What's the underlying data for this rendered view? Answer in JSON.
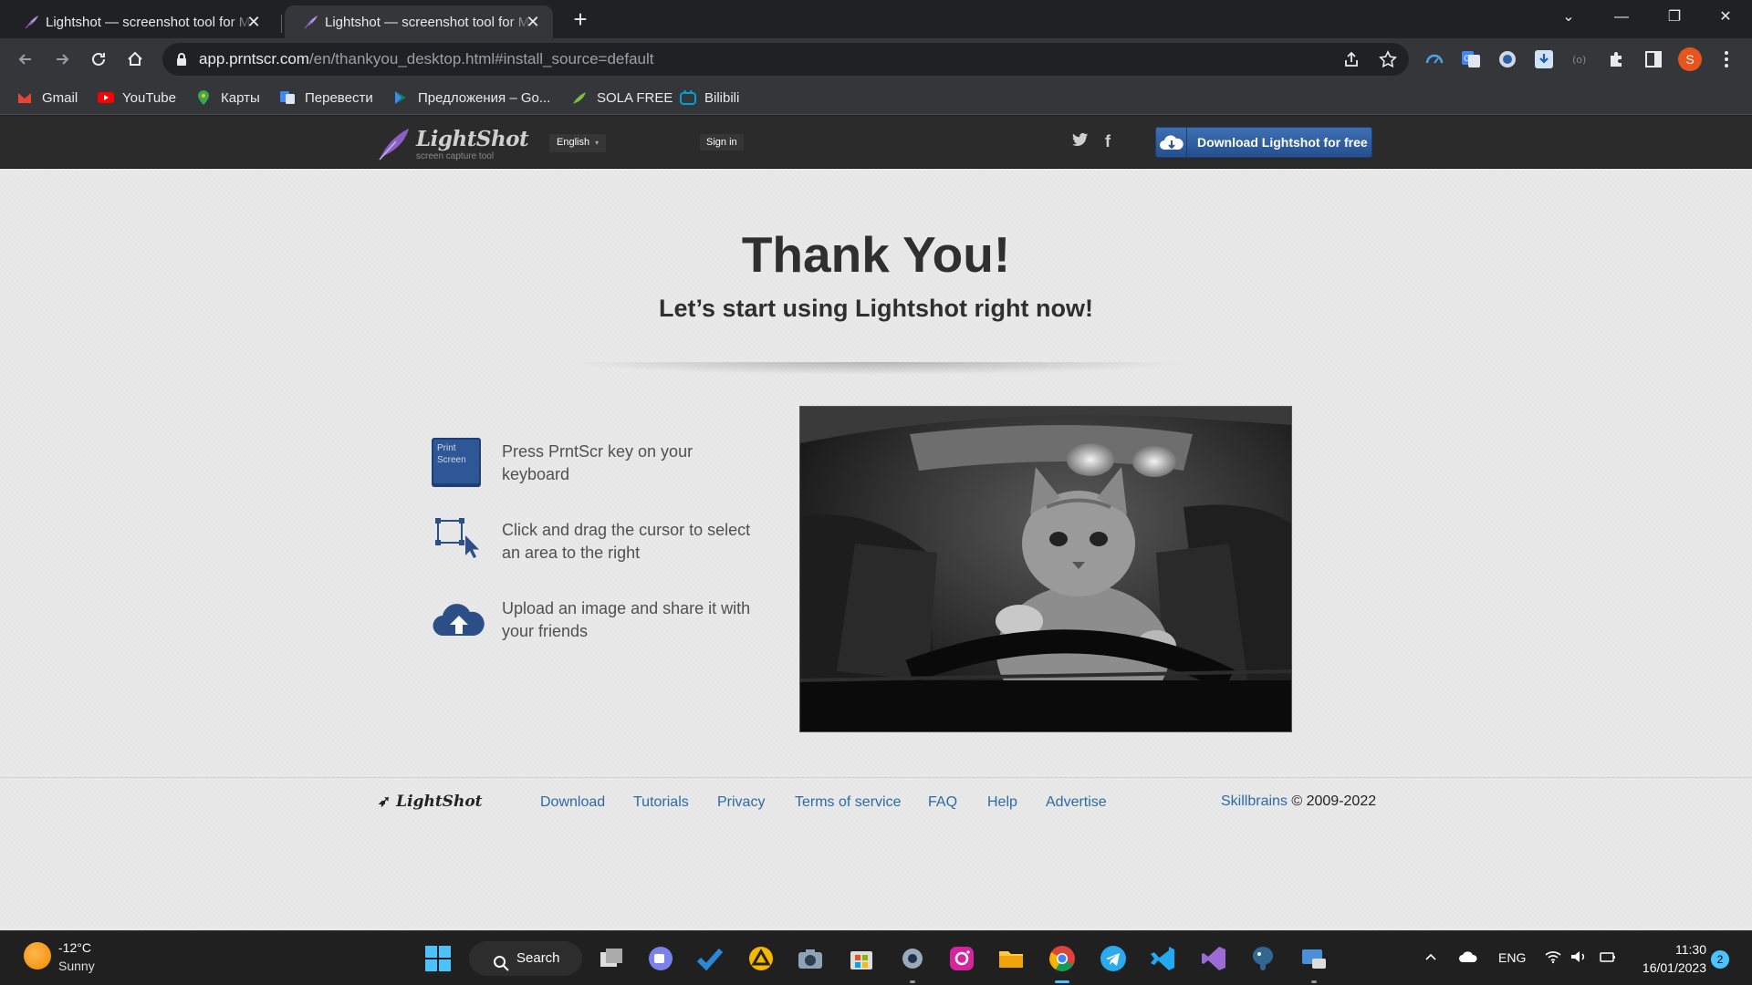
{
  "browser": {
    "tabs": [
      {
        "title": "Lightshot — screenshot tool for Mac & Win",
        "active": false
      },
      {
        "title": "Lightshot — screenshot tool for Mac & Win",
        "active": true
      }
    ],
    "new_tab_label": "+",
    "window_controls": {
      "tab_search": "⌄",
      "minimize": "—",
      "restore": "❐",
      "close": "✕"
    },
    "url_host": "app.prntscr.com",
    "url_path": "/en/thankyou_desktop.html#install_source=default",
    "profile_initial": "S",
    "bookmarks": [
      {
        "label": "Gmail",
        "icon": "gmail-icon",
        "color": "#ea4335"
      },
      {
        "label": "YouTube",
        "icon": "youtube-icon",
        "color": "#ff0000"
      },
      {
        "label": "Карты",
        "icon": "maps-icon",
        "color": "#34a853"
      },
      {
        "label": "Перевести",
        "icon": "translate-icon",
        "color": "#4285f4"
      },
      {
        "label": "Предложения – Go...",
        "icon": "play-icon",
        "color": "#01875f"
      },
      {
        "label": "SOLA FREE",
        "icon": "sola-icon",
        "color": "#7cc241"
      },
      {
        "label": "Bilibili",
        "icon": "bilibili-icon",
        "color": "#00a1d6"
      }
    ]
  },
  "site": {
    "logo_text": "LightShot",
    "logo_subtitle": "screen capture tool",
    "language": "English",
    "sign_in": "Sign in",
    "download_button": "Download Lightshot for free",
    "hero_title": "Thank You!",
    "hero_subtitle": "Let’s start using Lightshot right now!",
    "print_key_label": "Print Screen",
    "steps": [
      {
        "icon": "print-screen-key-icon",
        "text": "Press PrntScr key on your keyboard"
      },
      {
        "icon": "select-area-icon",
        "text": "Click and drag the cursor to select an area to the right"
      },
      {
        "icon": "upload-cloud-icon",
        "text": "Upload an image and share it with your friends"
      }
    ],
    "footer": {
      "logo_text": "LightShot",
      "links": [
        "Download",
        "Tutorials",
        "Privacy",
        "Terms of service",
        "FAQ",
        "Help",
        "Advertise"
      ],
      "copyright_brand": "Skillbrains",
      "copyright_text": " © 2009-2022"
    },
    "colors": {
      "header": "#2b2b2b",
      "accent": "#2c6aa6",
      "button": "#3565a8",
      "background": "#e9e9e9"
    }
  },
  "taskbar": {
    "weather_temp": "-12°C",
    "weather_desc": "Sunny",
    "search_label": "Search",
    "language": "ENG",
    "time": "11:30",
    "date": "16/01/2023",
    "notification_count": "2"
  }
}
